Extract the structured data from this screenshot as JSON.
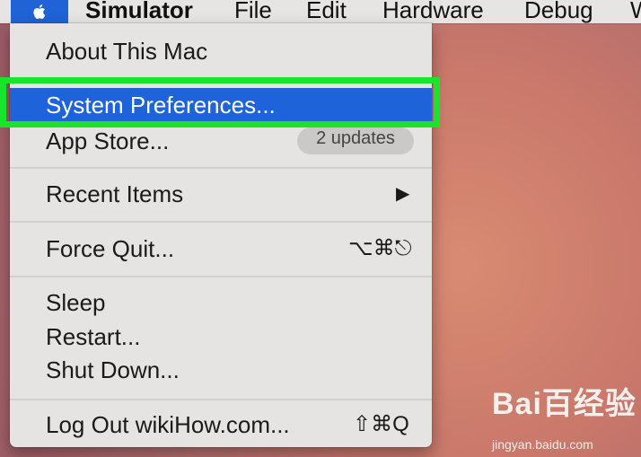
{
  "menubar": {
    "apple_icon": "apple-logo-icon",
    "items": [
      "Simulator",
      "File",
      "Edit",
      "Hardware",
      "Debug",
      "W"
    ]
  },
  "apple_menu": {
    "about": "About This Mac",
    "system_preferences": "System Preferences...",
    "app_store": "App Store...",
    "app_store_badge": "2 updates",
    "recent_items": "Recent Items",
    "recent_items_arrow": "▶",
    "force_quit": "Force Quit...",
    "force_quit_shortcut": "⌥⌘⎋",
    "sleep": "Sleep",
    "restart": "Restart...",
    "shut_down": "Shut Down...",
    "log_out": "Log Out wikiHow.com...",
    "log_out_shortcut": "⇧⌘Q"
  },
  "colors": {
    "highlight": "#1e63d9",
    "annotation": "#18e52a"
  },
  "watermark": {
    "logo": "Bai百经验",
    "url": "jingyan.baidu.com"
  }
}
